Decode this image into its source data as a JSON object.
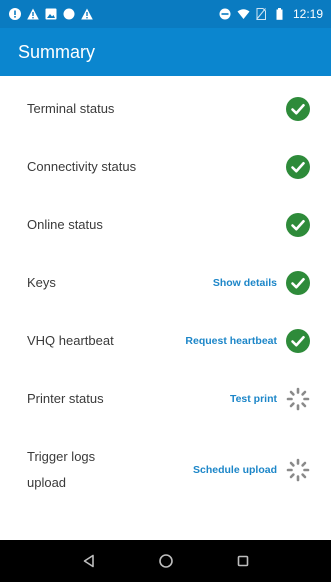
{
  "status_bar": {
    "time": "12:19",
    "left_icons": [
      "alert-circle-icon",
      "warning-icon",
      "image-icon",
      "dot-icon",
      "warning-icon"
    ],
    "right_icons": [
      "do-not-disturb-icon",
      "wifi-icon",
      "no-sim-icon",
      "battery-icon"
    ]
  },
  "app_bar": {
    "title": "Summary"
  },
  "colors": {
    "status_bar": "#0a7bc1",
    "app_bar": "#0b86cf",
    "check_green": "#2e8b3a",
    "link_blue": "#1c86c8",
    "pending_gray": "#888888"
  },
  "rows": [
    {
      "label": "Terminal status",
      "action": "",
      "status": "ok"
    },
    {
      "label": "Connectivity status",
      "action": "",
      "status": "ok"
    },
    {
      "label": "Online status",
      "action": "",
      "status": "ok"
    },
    {
      "label": "Keys",
      "action": "Show details",
      "status": "ok"
    },
    {
      "label": "VHQ heartbeat",
      "action": "Request heartbeat",
      "status": "ok"
    },
    {
      "label": "Printer status",
      "action": "Test print",
      "status": "pending"
    },
    {
      "label": "Trigger logs upload",
      "action": "Schedule upload",
      "status": "pending"
    }
  ],
  "nav_bar": {
    "buttons": [
      "back-icon",
      "home-icon",
      "recents-icon"
    ]
  }
}
